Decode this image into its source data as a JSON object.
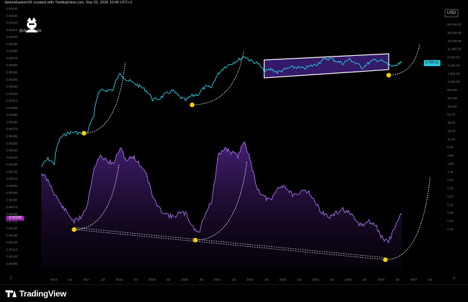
{
  "header": {
    "credit": "JamesEastonUK created with TradingView.com, Sep 22, 2026 10:45 UTC+1"
  },
  "watermark": {
    "name": "@JamesEastonUK",
    "icon": "avatar-icon"
  },
  "currency": "USD",
  "footer": {
    "brand": "TradingView",
    "corner_left": "Z",
    "corner_right": "A"
  },
  "price_tag": "2,700.12",
  "ratio_tag": "0.00159",
  "colors": {
    "price": "#26c6da",
    "ratio": "#9c6ade",
    "channel": "#ffffff",
    "channel_fill": "#3d1f7a",
    "marker": "#f5d000",
    "curve": "#ffffff"
  },
  "chart_data": {
    "type": "line",
    "title": "",
    "x_ticks": [
      "2016",
      "Jul",
      "2017",
      "Jul",
      "2018",
      "Jul",
      "2019",
      "Jul",
      "2020",
      "Jul",
      "2021",
      "Jul",
      "2022",
      "Jul",
      "2023",
      "Jul",
      "2024",
      "Jul",
      "2025",
      "Jul",
      "2026",
      "Jul",
      "2027",
      "Jul"
    ],
    "left_axis_ticks": [
      "0.00440",
      "0.00430",
      "0.00420",
      "0.00410",
      "0.00400",
      "0.00390",
      "0.00380",
      "0.00370",
      "0.00360",
      "0.00350",
      "0.00340",
      "0.00330",
      "0.00320",
      "0.00310",
      "0.00300",
      "0.00290",
      "0.00280",
      "0.00270",
      "0.00260",
      "0.00255",
      "0.00250",
      "0.00240",
      "0.00230",
      "0.00220",
      "0.00210",
      "0.00200",
      "0.00190",
      "0.00180",
      "0.00170",
      "0.00160",
      "0.00150",
      "0.00140",
      "0.00130",
      "0.00120",
      "0.00110",
      "0.00100",
      "0.00090"
    ],
    "right_axis_ticks": [
      "62,000.00",
      "32,000.00",
      "16,000.00",
      "11,000.00",
      "6,200.00",
      "3,100.00",
      "1,900.00",
      "1,100.00",
      "620.00",
      "310.00",
      "110.00",
      "62.00",
      "36.00",
      "16.00",
      "11.00",
      "6.20",
      "3.60",
      "1.90",
      "1.10",
      "0.60",
      "0.35",
      "0.20",
      "0.11",
      "0.06",
      "0.03",
      "0.01"
    ],
    "series": [
      {
        "x": [
          2015.6,
          2015.8,
          2016.0,
          2016.2,
          2016.4,
          2016.6,
          2016.8,
          2017.0,
          2017.2,
          2017.4,
          2017.6,
          2017.8,
          2018.0,
          2018.2,
          2018.4,
          2018.6,
          2018.8,
          2019.0,
          2019.2,
          2019.4,
          2019.6,
          2019.8,
          2020.0,
          2020.2,
          2020.4,
          2020.6,
          2020.8,
          2021.0,
          2021.2,
          2021.4,
          2021.6,
          2021.8,
          2022.0,
          2022.2,
          2022.4,
          2022.6,
          2022.8,
          2023.0,
          2023.2,
          2023.4,
          2023.6,
          2023.8,
          2024.0,
          2024.2,
          2024.4,
          2024.6,
          2024.8,
          2025.0,
          2025.2,
          2025.4,
          2025.6,
          2025.8,
          2026.0,
          2026.2,
          2026.4,
          2026.6
        ],
        "y": [
          0.8,
          1.5,
          1.0,
          8.0,
          11.0,
          12.0,
          11.0,
          10.0,
          40.0,
          300.0,
          310.0,
          330.0,
          1100.0,
          700.0,
          550.0,
          420.0,
          300.0,
          150.0,
          160.0,
          230.0,
          300.0,
          190.0,
          140.0,
          200.0,
          230.0,
          400.0,
          380.0,
          1100.0,
          1900.0,
          2500.0,
          3200.0,
          4300.0,
          3000.0,
          2500.0,
          1300.0,
          1600.0,
          1250.0,
          1500.0,
          1800.0,
          1850.0,
          1650.0,
          2000.0,
          2300.0,
          3300.0,
          3700.0,
          3000.0,
          2500.0,
          3400.0,
          2500.0,
          1800.0,
          2600.0,
          3300.0,
          3000.0,
          2200.0,
          1900.0,
          2700.12
        ]
      },
      {
        "x": [
          2015.6,
          2015.8,
          2016.0,
          2016.2,
          2016.4,
          2016.6,
          2016.8,
          2017.0,
          2017.2,
          2017.4,
          2017.6,
          2017.8,
          2018.0,
          2018.2,
          2018.4,
          2018.6,
          2018.8,
          2019.0,
          2019.2,
          2019.4,
          2019.6,
          2019.8,
          2020.0,
          2020.2,
          2020.4,
          2020.6,
          2020.8,
          2021.0,
          2021.2,
          2021.4,
          2021.6,
          2021.8,
          2022.0,
          2022.2,
          2022.4,
          2022.6,
          2022.8,
          2023.0,
          2023.2,
          2023.4,
          2023.6,
          2023.8,
          2024.0,
          2024.2,
          2024.4,
          2024.6,
          2024.8,
          2025.0,
          2025.2,
          2025.4,
          2025.6,
          2025.8,
          2026.0,
          2026.2,
          2026.4,
          2026.6
        ],
        "y": [
          0.0021,
          0.002,
          0.00185,
          0.0017,
          0.0016,
          0.0015,
          0.00155,
          0.0017,
          0.00215,
          0.0023,
          0.00225,
          0.0022,
          0.0024,
          0.00225,
          0.0023,
          0.0022,
          0.0021,
          0.0018,
          0.00165,
          0.0016,
          0.00155,
          0.0016,
          0.0016,
          0.00145,
          0.00135,
          0.0016,
          0.00175,
          0.0023,
          0.0024,
          0.00235,
          0.0023,
          0.0025,
          0.0022,
          0.0019,
          0.0018,
          0.00175,
          0.0019,
          0.00195,
          0.00185,
          0.0018,
          0.0019,
          0.00185,
          0.0017,
          0.0016,
          0.00155,
          0.0016,
          0.00165,
          0.0016,
          0.0015,
          0.00145,
          0.0015,
          0.00145,
          0.0013,
          0.00125,
          0.00145,
          0.00159
        ]
      }
    ],
    "markers": [
      {
        "panel": "price",
        "x": 2016.9,
        "y": 11.0
      },
      {
        "panel": "price",
        "x": 2020.2,
        "y": 100.0
      },
      {
        "panel": "price",
        "x": 2026.2,
        "y": 1000.0
      },
      {
        "panel": "ratio",
        "x": 2016.6,
        "y": 0.0014
      },
      {
        "panel": "ratio",
        "x": 2020.3,
        "y": 0.00127
      },
      {
        "panel": "ratio",
        "x": 2026.1,
        "y": 0.00103
      }
    ]
  }
}
